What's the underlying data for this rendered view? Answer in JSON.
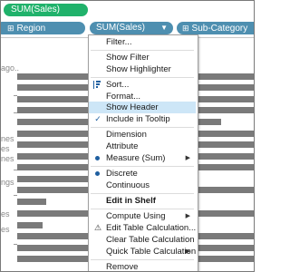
{
  "shelf": {
    "filter_pill": "SUM(Sales)",
    "columns": [
      {
        "label": "Region"
      },
      {
        "label": "SUM(Sales)"
      },
      {
        "label": "Sub-Category"
      }
    ]
  },
  "left_labels": [
    "ago..",
    "nes",
    "es",
    "nes",
    "ngs",
    "es",
    "es"
  ],
  "menu": {
    "items": [
      {
        "label": "Filter..."
      },
      {
        "label": "Show Filter"
      },
      {
        "label": "Show Highlighter"
      },
      {
        "label": "Sort..."
      },
      {
        "label": "Format..."
      },
      {
        "label": "Show Header"
      },
      {
        "label": "Include in Tooltip"
      },
      {
        "label": "Dimension"
      },
      {
        "label": "Attribute"
      },
      {
        "label": "Measure (Sum)"
      },
      {
        "label": "Discrete"
      },
      {
        "label": "Continuous"
      },
      {
        "label": "Edit in Shelf"
      },
      {
        "label": "Compute Using"
      },
      {
        "label": "Edit Table Calculation..."
      },
      {
        "label": "Clear Table Calculation"
      },
      {
        "label": "Quick Table Calculation"
      },
      {
        "label": "Remove"
      }
    ]
  },
  "icons": {
    "plus": "⊞",
    "caret": "▼",
    "submenu_arrow": "▶",
    "check": "✓",
    "warning": "⚠"
  },
  "colors": {
    "filter_pill": "#20b26b",
    "dimension_pill": "#4e8fb0",
    "highlight": "#cde6f7",
    "bar": "#7a7a7a"
  }
}
